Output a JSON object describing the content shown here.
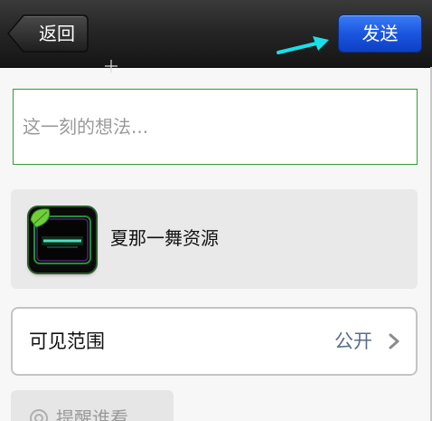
{
  "navbar": {
    "back_label": "返回",
    "send_label": "发送"
  },
  "composer": {
    "placeholder": "这一刻的想法...",
    "value": ""
  },
  "share_card": {
    "title": "夏那一舞资源",
    "thumbnail_icon": "leaf-logo-icon"
  },
  "visibility": {
    "label": "可见范围",
    "value": "公开"
  },
  "mention": {
    "label": "提醒谁看"
  },
  "colors": {
    "send_button": "#1b56e0",
    "annotation_arrow": "#19e0e8",
    "input_border": "#2fa02f",
    "visibility_value": "#5a6e88"
  }
}
